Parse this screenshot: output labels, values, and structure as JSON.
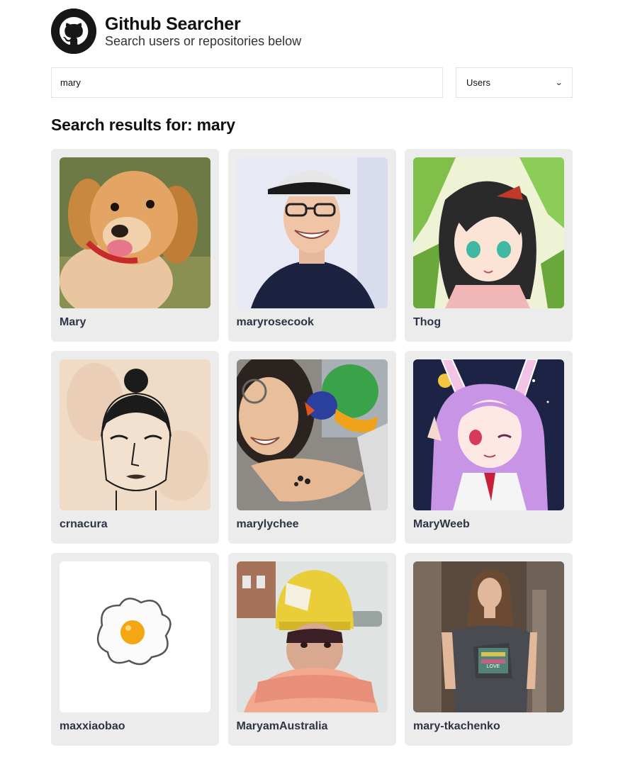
{
  "app": {
    "title": "Github Searcher",
    "subtitle": "Search users or repositories below",
    "logo_icon": "github-octocat-icon"
  },
  "search": {
    "value": "mary",
    "type_selected": "Users"
  },
  "results": {
    "heading": "Search results for: mary",
    "users": [
      {
        "login": "Mary",
        "avatar": "puppy"
      },
      {
        "login": "maryrosecook",
        "avatar": "person-cap-glasses"
      },
      {
        "login": "Thog",
        "avatar": "anime-girl-dark-hair"
      },
      {
        "login": "crnacura",
        "avatar": "sketch-face"
      },
      {
        "login": "marylychee",
        "avatar": "person-parrot"
      },
      {
        "login": "MaryWeeb",
        "avatar": "anime-bunny-girl"
      },
      {
        "login": "maxxiaobao",
        "avatar": "fried-egg"
      },
      {
        "login": "MaryamAustralia",
        "avatar": "person-yellow-hat-scarf"
      },
      {
        "login": "mary-tkachenko",
        "avatar": "person-long-hair"
      }
    ]
  },
  "colors": {
    "card_bg": "#ececec",
    "username_text": "#2d3445"
  }
}
